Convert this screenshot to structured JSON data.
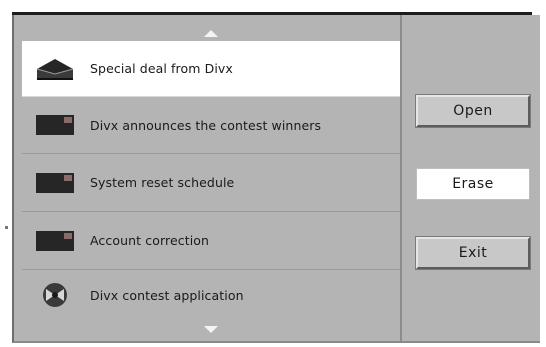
{
  "messages": [
    {
      "label": "Special deal from Divx",
      "icon": "open-envelope-icon",
      "selected": true
    },
    {
      "label": "Divx announces the contest winners",
      "icon": "envelope-icon",
      "selected": false
    },
    {
      "label": "System reset schedule",
      "icon": "envelope-icon",
      "selected": false
    },
    {
      "label": "Account correction",
      "icon": "envelope-icon",
      "selected": false
    },
    {
      "label": "Divx contest application",
      "icon": "divx-badge-icon",
      "selected": false
    }
  ],
  "buttons": {
    "open": "Open",
    "erase": "Erase",
    "exit": "Exit"
  },
  "colors": {
    "panel": "#b4b4b4",
    "selected_row": "#ffffff",
    "envelope": "#262626",
    "envelope_corner": "#8a6a6a"
  }
}
